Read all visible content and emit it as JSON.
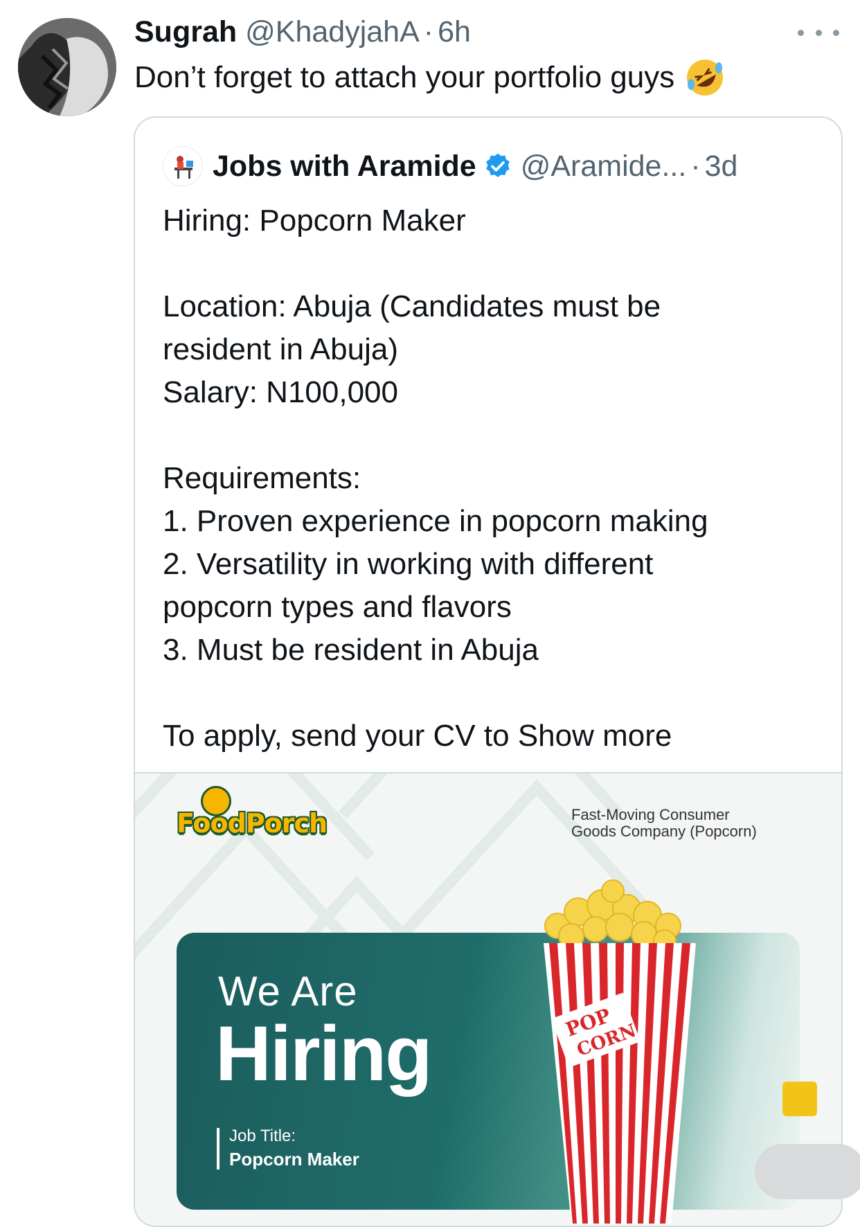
{
  "tweet": {
    "author_name": "Sugrah",
    "author_handle": "@KhadyjahA",
    "time_sep": "·",
    "time": "6h",
    "text": "Don’t forget to attach your portfolio guys",
    "emoji": "rolling-on-floor-laughing-emoji"
  },
  "quote": {
    "author_name": "Jobs with Aramide",
    "author_handle": "@Aramide...",
    "time_sep": "·",
    "time": "3d",
    "lines": [
      "Hiring: Popcorn Maker",
      "",
      "Location: Abuja (Candidates must be",
      "resident in Abuja)",
      "Salary: N100,000",
      "",
      "Requirements:",
      "1. Proven experience in popcorn making",
      "2. Versatility in working with different",
      "popcorn types and flavors",
      "3. Must be resident in Abuja",
      ""
    ],
    "last_line": "To apply, send your CV to",
    "show_more": "Show more"
  },
  "media": {
    "logo_text": "FoodPorch",
    "company_line1": "Fast-Moving Consumer",
    "company_line2": "Goods Company (Popcorn)",
    "we_are": "We Are",
    "hiring": "Hiring",
    "job_title_label": "Job Title:",
    "job_title_value": "Popcorn Maker",
    "popcorn_text_1": "POP",
    "popcorn_text_2": "CORN"
  },
  "colors": {
    "text": "#0f1419",
    "muted": "#536471",
    "verified": "#1d9bf0",
    "border": "#cfd9de",
    "panel": "#1f6d6a",
    "accent_yellow": "#f2c41a"
  }
}
